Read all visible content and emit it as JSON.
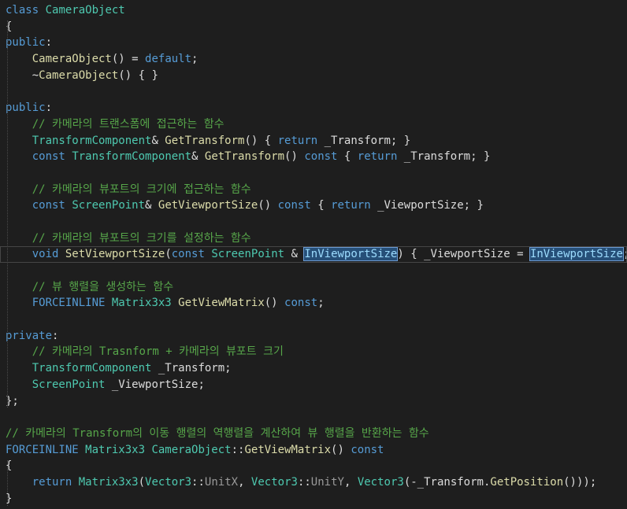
{
  "editor": {
    "lines": [
      [
        [
          "kw",
          "class"
        ],
        [
          "pl",
          " "
        ],
        [
          "ty",
          "CameraObject"
        ]
      ],
      [
        [
          "pl",
          "{"
        ]
      ],
      [
        [
          "kw",
          "public"
        ],
        [
          "pl",
          ":"
        ]
      ],
      [
        [
          "pl",
          "    "
        ],
        [
          "fn",
          "CameraObject"
        ],
        [
          "pl",
          "() = "
        ],
        [
          "kw",
          "default"
        ],
        [
          "pl",
          ";"
        ]
      ],
      [
        [
          "pl",
          "    ~"
        ],
        [
          "fn",
          "CameraObject"
        ],
        [
          "pl",
          "() { }"
        ]
      ],
      [],
      [
        [
          "kw",
          "public"
        ],
        [
          "pl",
          ":"
        ]
      ],
      [
        [
          "pl",
          "    "
        ],
        [
          "cm",
          "// 카메라의 트랜스폼에 접근하는 함수"
        ]
      ],
      [
        [
          "pl",
          "    "
        ],
        [
          "ty",
          "TransformComponent"
        ],
        [
          "pl",
          "& "
        ],
        [
          "fn",
          "GetTransform"
        ],
        [
          "pl",
          "() { "
        ],
        [
          "kw",
          "return"
        ],
        [
          "pl",
          " _Transform; }"
        ]
      ],
      [
        [
          "pl",
          "    "
        ],
        [
          "kw",
          "const"
        ],
        [
          "pl",
          " "
        ],
        [
          "ty",
          "TransformComponent"
        ],
        [
          "pl",
          "& "
        ],
        [
          "fn",
          "GetTransform"
        ],
        [
          "pl",
          "() "
        ],
        [
          "kw",
          "const"
        ],
        [
          "pl",
          " { "
        ],
        [
          "kw",
          "return"
        ],
        [
          "pl",
          " _Transform; }"
        ]
      ],
      [],
      [
        [
          "pl",
          "    "
        ],
        [
          "cm",
          "// 카메라의 뷰포트의 크기에 접근하는 함수"
        ]
      ],
      [
        [
          "pl",
          "    "
        ],
        [
          "kw",
          "const"
        ],
        [
          "pl",
          " "
        ],
        [
          "ty",
          "ScreenPoint"
        ],
        [
          "pl",
          "& "
        ],
        [
          "fn",
          "GetViewportSize"
        ],
        [
          "pl",
          "() "
        ],
        [
          "kw",
          "const"
        ],
        [
          "pl",
          " { "
        ],
        [
          "kw",
          "return"
        ],
        [
          "pl",
          " _ViewportSize; }"
        ]
      ],
      [],
      [
        [
          "pl",
          "    "
        ],
        [
          "cm",
          "// 카메라의 뷰포트의 크기를 설정하는 함수"
        ]
      ],
      [
        [
          "pl",
          "    "
        ],
        [
          "kw",
          "void"
        ],
        [
          "pl",
          " "
        ],
        [
          "fn",
          "SetViewportSize"
        ],
        [
          "pl",
          "("
        ],
        [
          "kw",
          "const"
        ],
        [
          "pl",
          " "
        ],
        [
          "ty",
          "ScreenPoint"
        ],
        [
          "pl",
          " & "
        ],
        [
          "hl",
          "InViewportSize"
        ],
        [
          "pl",
          ") { _ViewportSize = "
        ],
        [
          "hl",
          "InViewportSize"
        ],
        [
          "pl",
          "; }"
        ]
      ],
      [],
      [
        [
          "pl",
          "    "
        ],
        [
          "cm",
          "// 뷰 행렬을 생성하는 함수"
        ]
      ],
      [
        [
          "pl",
          "    "
        ],
        [
          "kw",
          "FORCEINLINE"
        ],
        [
          "pl",
          " "
        ],
        [
          "ty",
          "Matrix3x3"
        ],
        [
          "pl",
          " "
        ],
        [
          "fn",
          "GetViewMatrix"
        ],
        [
          "pl",
          "() "
        ],
        [
          "kw",
          "const"
        ],
        [
          "pl",
          ";"
        ]
      ],
      [],
      [
        [
          "kw",
          "private"
        ],
        [
          "pl",
          ":"
        ]
      ],
      [
        [
          "pl",
          "    "
        ],
        [
          "cm",
          "// 카메라의 Trasnform + 카메라의 뷰포트 크기"
        ]
      ],
      [
        [
          "pl",
          "    "
        ],
        [
          "ty",
          "TransformComponent"
        ],
        [
          "pl",
          " _Transform;"
        ]
      ],
      [
        [
          "pl",
          "    "
        ],
        [
          "ty",
          "ScreenPoint"
        ],
        [
          "pl",
          " _ViewportSize;"
        ]
      ],
      [
        [
          "pl",
          "};"
        ]
      ],
      [],
      [
        [
          "cm",
          "// 카메라의 Transform의 이동 행렬의 역행렬을 계산하여 뷰 행렬을 반환하는 함수"
        ]
      ],
      [
        [
          "kw",
          "FORCEINLINE"
        ],
        [
          "pl",
          " "
        ],
        [
          "ty",
          "Matrix3x3"
        ],
        [
          "pl",
          " "
        ],
        [
          "ty",
          "CameraObject"
        ],
        [
          "pl",
          "::"
        ],
        [
          "fn",
          "GetViewMatrix"
        ],
        [
          "pl",
          "() "
        ],
        [
          "kw",
          "const"
        ]
      ],
      [
        [
          "pl",
          "{"
        ]
      ],
      [
        [
          "pl",
          "    "
        ],
        [
          "kw",
          "return"
        ],
        [
          "pl",
          " "
        ],
        [
          "ty",
          "Matrix3x3"
        ],
        [
          "pl",
          "("
        ],
        [
          "ty",
          "Vector3"
        ],
        [
          "pl",
          "::"
        ],
        [
          "pm",
          "UnitX"
        ],
        [
          "pl",
          ", "
        ],
        [
          "ty",
          "Vector3"
        ],
        [
          "pl",
          "::"
        ],
        [
          "pm",
          "UnitY"
        ],
        [
          "pl",
          ", "
        ],
        [
          "ty",
          "Vector3"
        ],
        [
          "pl",
          "(-_Transform."
        ],
        [
          "fn",
          "GetPosition"
        ],
        [
          "pl",
          "()));"
        ]
      ],
      [
        [
          "pl",
          "}"
        ]
      ]
    ]
  }
}
